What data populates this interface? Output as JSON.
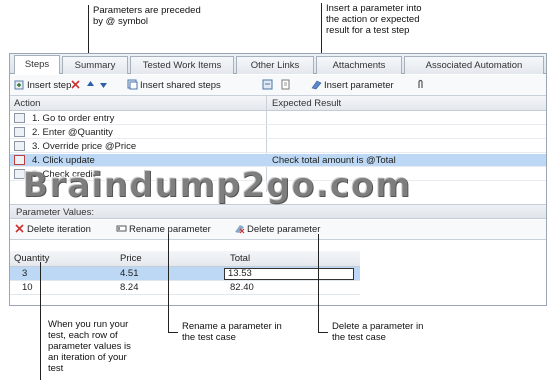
{
  "callouts": {
    "parameters_prefix": [
      "Parameters are preceded",
      "by @ symbol"
    ],
    "insert_parameter": [
      "Insert a parameter into",
      "the action or expected",
      "result for a test step"
    ],
    "iteration": [
      "When you run your",
      "test, each row of",
      "parameter values is",
      "an iteration of your",
      "test"
    ],
    "rename": [
      "Rename a parameter in",
      "the test case"
    ],
    "delete": [
      "Delete a parameter in",
      "the test case"
    ]
  },
  "tabs": [
    "Steps",
    "Summary",
    "Tested Work Items",
    "Other Links",
    "Attachments",
    "Associated Automation"
  ],
  "toolbar": {
    "insert_step": "Insert step",
    "insert_shared_steps": "Insert shared steps",
    "insert_parameter": "Insert parameter"
  },
  "steps_grid": {
    "col_action": "Action",
    "col_expected": "Expected Result",
    "rows": [
      {
        "action": "1.  Go to order entry",
        "expected": ""
      },
      {
        "action": "2.  Enter @Quantity",
        "expected": ""
      },
      {
        "action": "3.  Override price @Price",
        "expected": ""
      },
      {
        "action": "4.  Click update",
        "expected": "Check total amount is @Total"
      },
      {
        "action": "5.  Check credit",
        "expected": ""
      }
    ]
  },
  "parameter_values_label": "Parameter Values:",
  "param_toolbar": {
    "delete_iteration": "Delete iteration",
    "rename_parameter": "Rename parameter",
    "delete_parameter": "Delete parameter"
  },
  "param_table": {
    "headers": [
      "Quantity",
      "Price",
      "Total"
    ],
    "rows": [
      [
        "3",
        "4.51",
        "13.53"
      ],
      [
        "10",
        "8.24",
        "82.40"
      ]
    ]
  },
  "watermark": "Braindump2go.com",
  "colors": {
    "selection": "#bcd8f4",
    "border": "#9aa6b4",
    "header_grad": "#e4e8ed"
  }
}
